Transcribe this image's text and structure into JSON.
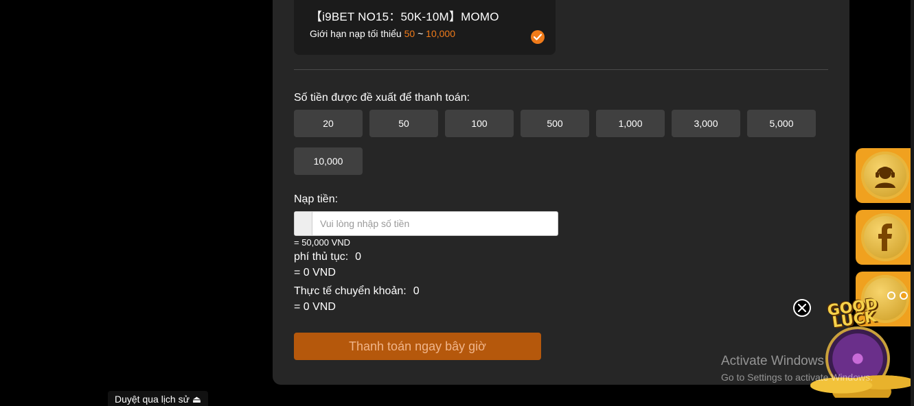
{
  "channel": {
    "title": "【i9BET NO15：50K-10M】MOMO",
    "limit_label": "Giới hạn nạp tối thiểu",
    "limit_min": "50",
    "limit_sep": "~",
    "limit_max": "10,000"
  },
  "suggest": {
    "label": "Số tiền được đề xuất để thanh toán:",
    "amounts": [
      "20",
      "50",
      "100",
      "500",
      "1,000",
      "3,000",
      "5,000",
      "10,000"
    ]
  },
  "deposit": {
    "label": "Nạp tiền:",
    "placeholder": "Vui lòng nhập số tiền",
    "conversion": "= 50,000 VND"
  },
  "fee": {
    "label": "phí thủ tục:",
    "value": "0",
    "vnd": "= 0 VND"
  },
  "actual": {
    "label": "Thực tế chuyển khoản:",
    "value": "0",
    "vnd": "= 0 VND"
  },
  "pay_button": "Thanh toán ngay bây giờ",
  "history_link": "Duyệt qua lịch sử ⏏",
  "promo": {
    "text_line1": "GOOD",
    "text_line2": "LUCK"
  },
  "windows": {
    "title": "Activate Windows",
    "subtitle": "Go to Settings to activate Windows."
  },
  "colors": {
    "accent": "#f07b1a",
    "pay_button": "#b5580c",
    "panel": "#262626",
    "float_button": "#f0a11f"
  },
  "icons": {
    "support": "headset-support-icon",
    "facebook": "facebook-icon",
    "check": "check-icon",
    "close": "close-icon"
  }
}
